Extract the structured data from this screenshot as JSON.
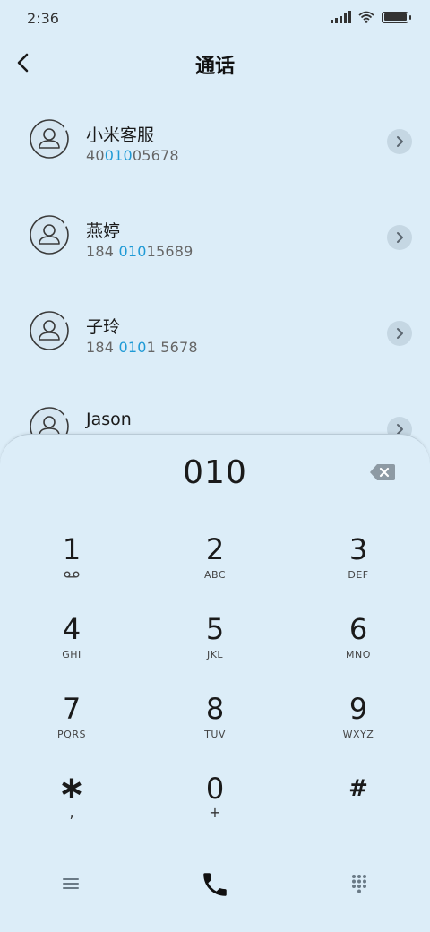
{
  "status_bar": {
    "time": "2:36",
    "battery_level": 1.0
  },
  "header": {
    "title": "通话"
  },
  "contacts": [
    {
      "name": "小米客服",
      "number_before": "40",
      "number_match": "010",
      "number_after": "05678"
    },
    {
      "name": "燕婷",
      "number_before": "184 ",
      "number_match": "010",
      "number_after": "15689"
    },
    {
      "name": "子玲",
      "number_before": "184 ",
      "number_match": "010",
      "number_after": "1 5678"
    },
    {
      "name": "Jason",
      "number_before": "",
      "number_match": "",
      "number_after": ""
    }
  ],
  "dialer": {
    "number": "010",
    "keys": [
      {
        "digit": "1",
        "letters": "",
        "sub_icon": "voicemail-icon"
      },
      {
        "digit": "2",
        "letters": "ABC"
      },
      {
        "digit": "3",
        "letters": "DEF"
      },
      {
        "digit": "4",
        "letters": "GHI"
      },
      {
        "digit": "5",
        "letters": "JKL"
      },
      {
        "digit": "6",
        "letters": "MNO"
      },
      {
        "digit": "7",
        "letters": "PQRS"
      },
      {
        "digit": "8",
        "letters": "TUV"
      },
      {
        "digit": "9",
        "letters": "WXYZ"
      },
      {
        "digit": "∗",
        "letters": ","
      },
      {
        "digit": "0",
        "letters": "+"
      },
      {
        "digit": "#",
        "letters": ""
      }
    ]
  },
  "colors": {
    "background": "#dcedf8",
    "highlight": "#1e9ad6",
    "text": "#1a1a1a",
    "secondary_text": "#666666"
  }
}
